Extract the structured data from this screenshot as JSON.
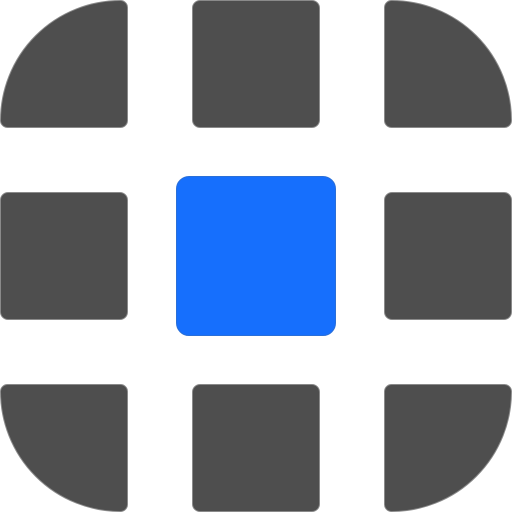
{
  "icon": {
    "name": "grid-focus-icon",
    "colors": {
      "tile": "#4e4e4e",
      "tile_border": "#8a8a8a",
      "accent": "#166ffd",
      "background": "#ffffff"
    },
    "tiles": [
      {
        "id": "top-left",
        "shape": "quarter-circle"
      },
      {
        "id": "top-center",
        "shape": "rounded-square"
      },
      {
        "id": "top-right",
        "shape": "quarter-circle"
      },
      {
        "id": "middle-left",
        "shape": "rounded-square"
      },
      {
        "id": "center",
        "shape": "rounded-square",
        "highlighted": true
      },
      {
        "id": "middle-right",
        "shape": "rounded-square"
      },
      {
        "id": "bottom-left",
        "shape": "quarter-circle"
      },
      {
        "id": "bottom-center",
        "shape": "rounded-square"
      },
      {
        "id": "bottom-right",
        "shape": "quarter-circle"
      }
    ]
  }
}
